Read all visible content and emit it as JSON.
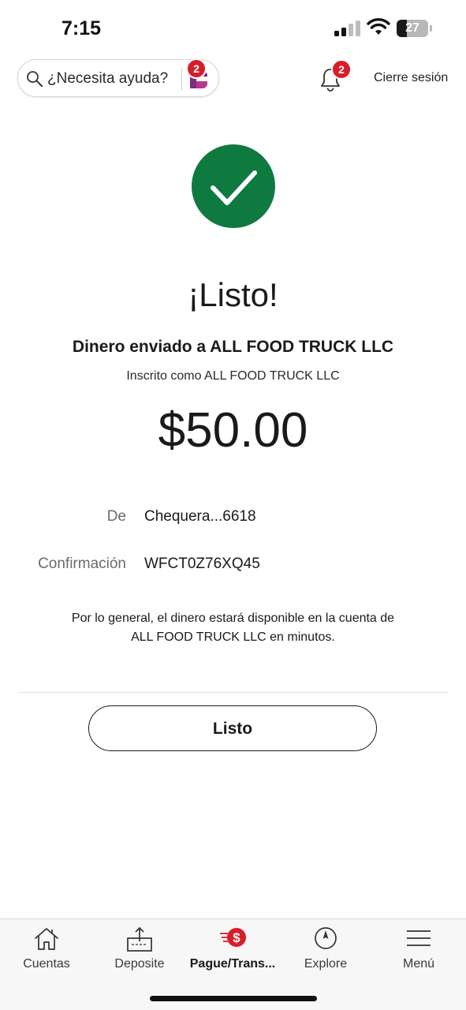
{
  "status_bar": {
    "time": "7:15",
    "battery": "27"
  },
  "header": {
    "search_placeholder": "¿Necesita ayuda?",
    "assistant_badge": "2",
    "notifications_badge": "2",
    "logout_label": "Cierre sesión"
  },
  "confirmation": {
    "title": "¡Listo!",
    "sent_to": "Dinero enviado a ALL FOOD TRUCK LLC",
    "enrolled_as": "Inscrito como ALL FOOD TRUCK LLC",
    "amount": "$50.00",
    "details": {
      "from_label": "De",
      "from_value": "Chequera...6618",
      "confirmation_label": "Confirmación",
      "confirmation_value": "WFCT0Z76XQ45"
    },
    "note": "Por lo general, el dinero estará disponible en la cuenta de ALL FOOD TRUCK LLC en minutos.",
    "done_label": "Listo"
  },
  "tabbar": {
    "items": [
      {
        "label": "Cuentas",
        "icon": "home-icon"
      },
      {
        "label": "Deposite",
        "icon": "deposit-icon"
      },
      {
        "label": "Pague/Trans...",
        "icon": "pay-transfer-icon"
      },
      {
        "label": "Explore",
        "icon": "compass-icon"
      },
      {
        "label": "Menú",
        "icon": "menu-icon"
      }
    ]
  },
  "colors": {
    "success_green": "#0f7a40",
    "badge_red": "#d71e28",
    "assistant_purple": "#7b2d82"
  }
}
